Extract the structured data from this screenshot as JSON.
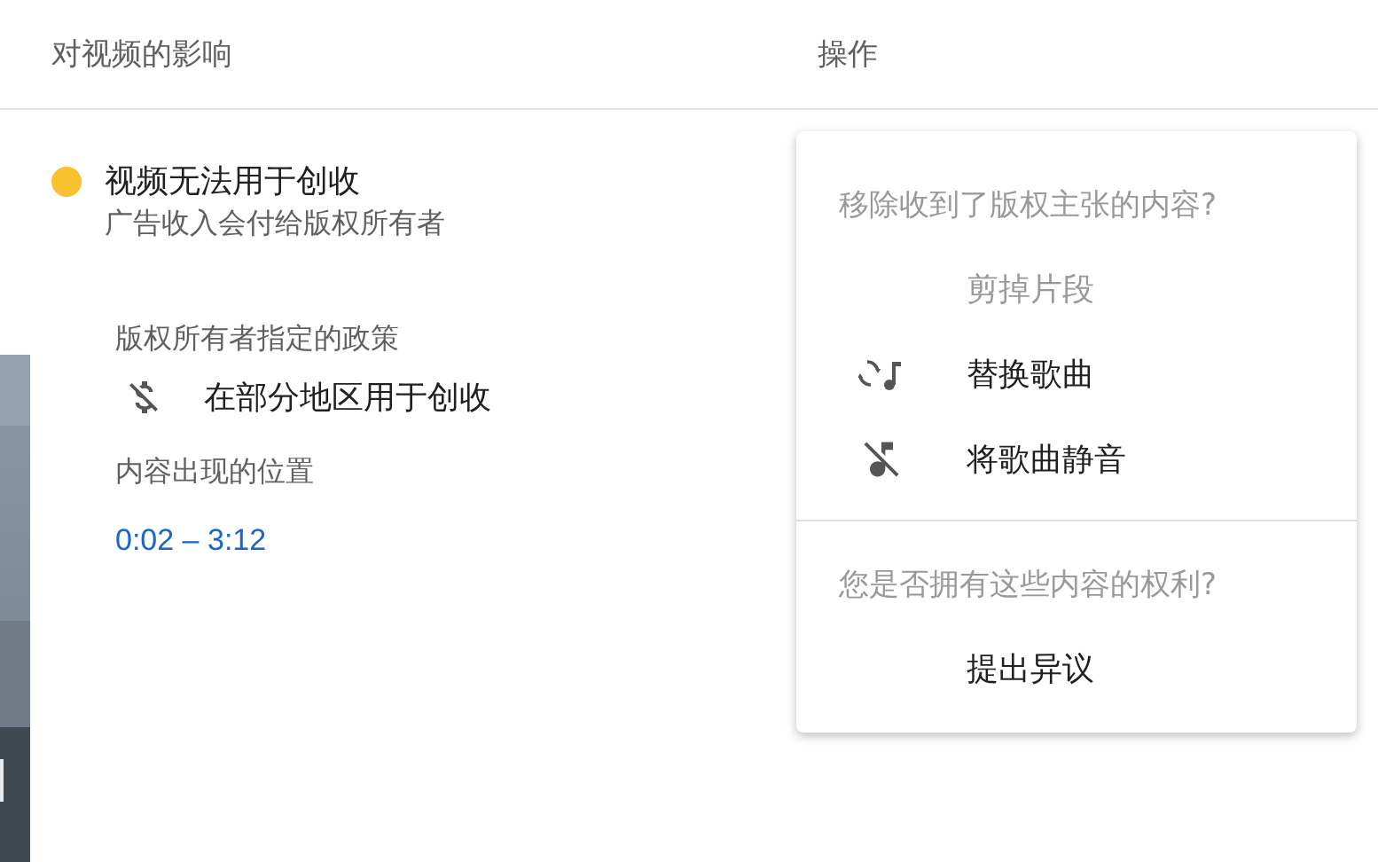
{
  "columns": [
    "对视频的影响",
    "操作"
  ],
  "impact": {
    "color": "#f7c22d",
    "title": "视频无法用于创收",
    "subtitle": "广告收入会付给版权所有者"
  },
  "policy": {
    "label": "版权所有者指定的政策",
    "value": "在部分地区用于创收"
  },
  "location": {
    "label": "内容出现的位置",
    "link": "0:02 – 3:12"
  },
  "thumbnail": {
    "kind": "picture"
  },
  "menu": {
    "sections": [
      {
        "heading": "移除收到了版权主张的内容?",
        "items": [
          {
            "label": "剪掉片段",
            "kind": "plain",
            "disabled": true
          },
          {
            "label": "替换歌曲",
            "kind": "swap",
            "disabled": false
          },
          {
            "label": "将歌曲静音",
            "kind": "mute",
            "disabled": false
          }
        ]
      },
      {
        "heading": "您是否拥有这些内容的权利?",
        "items": [
          {
            "label": "提出异议",
            "kind": "plain",
            "disabled": false
          }
        ]
      }
    ]
  }
}
